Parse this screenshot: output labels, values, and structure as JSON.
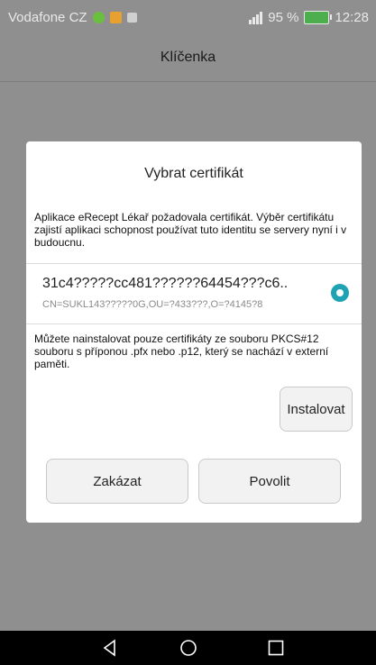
{
  "status_bar": {
    "carrier": "Vodafone CZ",
    "battery_percent": "95 %",
    "time": "12:28",
    "battery_level": 0.95,
    "icons": [
      "notification-app-icon",
      "notification-orange-icon",
      "notification-image-icon",
      "signal-icon",
      "battery-charging-icon"
    ]
  },
  "app_bar": {
    "title": "Klíčenka"
  },
  "dialog": {
    "title": "Vybrat certifikát",
    "message": "Aplikace eRecept Lékař požadovala certifikát. Výběr certifikátu zajistí aplikaci schopnost používat tuto identitu se servery nyní i v budoucnu.",
    "certificate": {
      "name": "31c4?????cc481??????64454???c6..",
      "subject": "CN=SUKL143?????0G,OU=?433???,O=?4145?8",
      "selected": true
    },
    "install_note": "Můžete nainstalovat pouze certifikáty ze souboru PKCS#12 souboru s příponou .pfx nebo .p12, který se nachází v externí paměti.",
    "install_label": "Instalovat",
    "deny_label": "Zakázat",
    "allow_label": "Povolit"
  },
  "nav_bar": {
    "icons": [
      "back-icon",
      "home-icon",
      "recent-apps-icon"
    ]
  },
  "colors": {
    "accent": "#1fa3b4",
    "scrim": "#8f8f8f",
    "battery": "#4cae4c"
  }
}
